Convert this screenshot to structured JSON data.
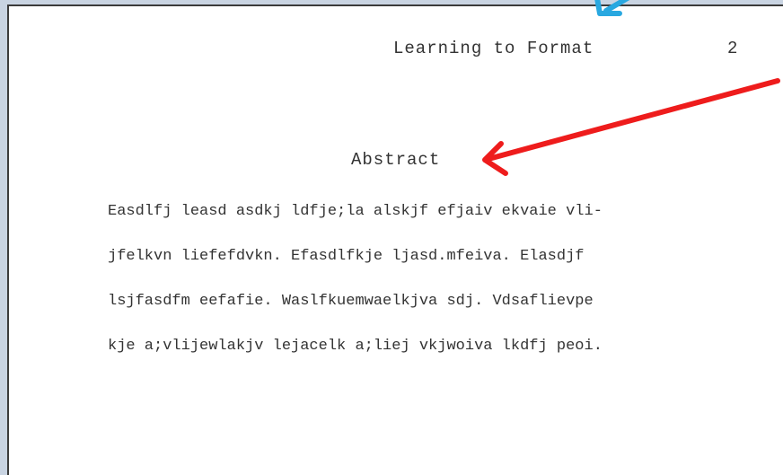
{
  "document": {
    "running_head": "Learning to Format",
    "page_number": "2",
    "abstract_title": "Abstract",
    "body_lines": [
      "Easdlfj leasd asdkj ldfje;la alskjf efjaiv ekvaie vli-",
      "jfelkvn liefefdvkn. Efasdlfkje ljasd.mfeiva. Elasdjf",
      "lsjfasdfm eefafie. Waslfkuemwaelkjva sdj. Vdsaflievpe",
      "kje a;vlijewlakjv lejacelk a;liej vkjwoiva lkdfj peoi."
    ]
  },
  "annotations": [
    {
      "icon": "arrow-icon",
      "color": "#29a8e0"
    },
    {
      "icon": "arrow-icon",
      "color": "#ee1c1c"
    }
  ]
}
